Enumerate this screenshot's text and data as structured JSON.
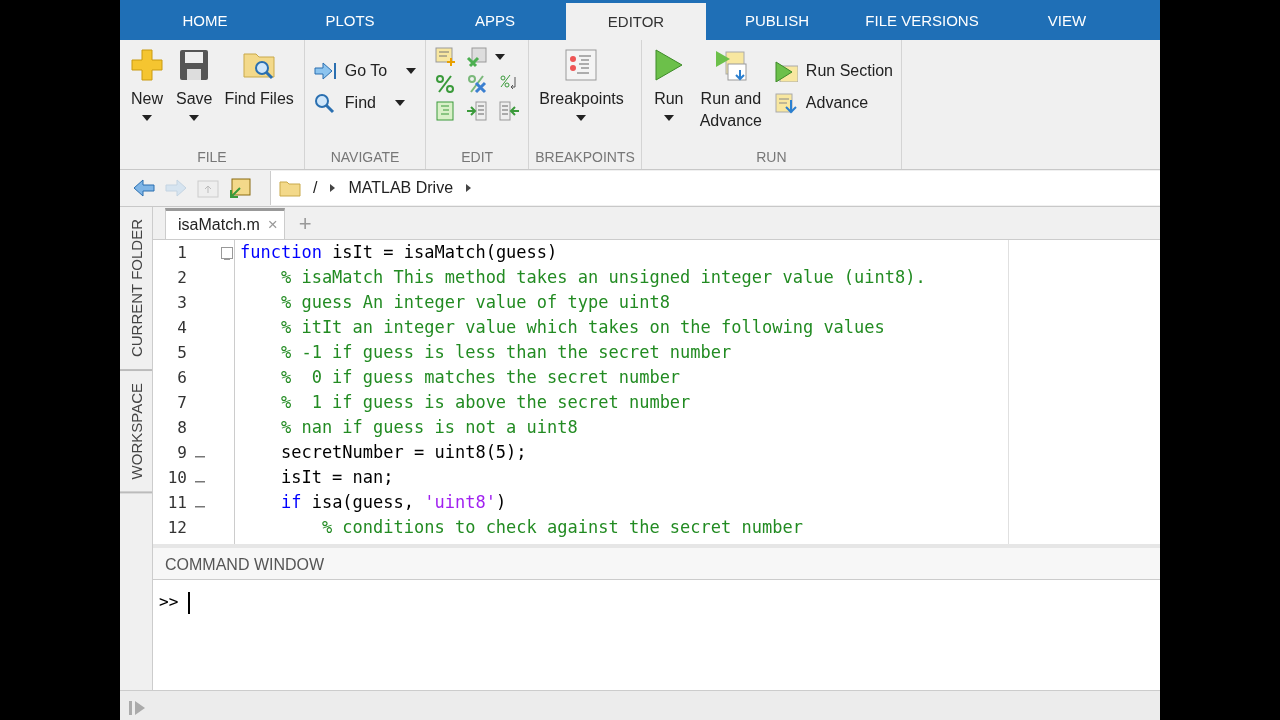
{
  "tabs": [
    {
      "label": "HOME",
      "selected": false
    },
    {
      "label": "PLOTS",
      "selected": false
    },
    {
      "label": "APPS",
      "selected": false
    },
    {
      "label": "EDITOR",
      "selected": true
    },
    {
      "label": "PUBLISH",
      "selected": false
    },
    {
      "label": "FILE VERSIONS",
      "selected": false
    },
    {
      "label": "VIEW",
      "selected": false
    }
  ],
  "ribbon": {
    "groups": [
      {
        "label": "FILE",
        "kind": "large",
        "buttons": [
          {
            "label": "New",
            "dropdown": true
          },
          {
            "label": "Save",
            "dropdown": true
          },
          {
            "label": "Find Files",
            "dropdown": false
          }
        ]
      },
      {
        "label": "NAVIGATE",
        "kind": "small",
        "buttons": [
          {
            "label": "Go To",
            "dropdown": true
          },
          {
            "label": "Find",
            "dropdown": true
          }
        ]
      },
      {
        "label": "EDIT",
        "kind": "icons",
        "rows": [
          [
            {
              "dropdown": false
            },
            {
              "dropdown": true
            }
          ],
          [
            {
              "dropdown": false
            },
            {
              "dropdown": false
            },
            {
              "dropdown": false
            }
          ],
          [
            {
              "dropdown": false
            },
            {
              "dropdown": false
            },
            {
              "dropdown": false
            }
          ]
        ]
      },
      {
        "label": "BREAKPOINTS",
        "kind": "large",
        "buttons": [
          {
            "label": "Breakpoints",
            "dropdown": true
          }
        ]
      },
      {
        "label": "RUN",
        "kind": "mixed",
        "buttons": [
          {
            "label": "Run",
            "dropdown": true
          },
          {
            "label": "Run and Advance",
            "dropdown": false
          }
        ],
        "small_buttons": [
          {
            "label": "Run Section",
            "dropdown": false
          },
          {
            "label": "Advance",
            "dropdown": false
          }
        ]
      }
    ]
  },
  "address_bar": {
    "nav_buttons": [
      {
        "disabled": false
      },
      {
        "disabled": true
      },
      {
        "disabled": true
      },
      {
        "disabled": false
      }
    ],
    "path": [
      {
        "label": "/"
      },
      {
        "label": "MATLAB Drive"
      }
    ]
  },
  "side_panels": [
    {
      "label": "CURRENT FOLDER"
    },
    {
      "label": "WORKSPACE"
    }
  ],
  "editor": {
    "tabs": [
      {
        "label": "isaMatch.m",
        "selected": true,
        "close": "×"
      }
    ],
    "new_tab": "+",
    "lines": [
      {
        "number": "1",
        "fold": true,
        "executable": false,
        "tokens": [
          {
            "kind": "keyword",
            "text": "function"
          },
          {
            "kind": "plain",
            "text": " isIt = isaMatch(guess)"
          }
        ]
      },
      {
        "number": "2",
        "fold": false,
        "executable": false,
        "tokens": [
          {
            "kind": "comment",
            "text": "    % isaMatch This method takes an unsigned integer value (uint8)."
          }
        ]
      },
      {
        "number": "3",
        "fold": false,
        "executable": false,
        "tokens": [
          {
            "kind": "comment",
            "text": "    % guess An integer value of type uint8"
          }
        ]
      },
      {
        "number": "4",
        "fold": false,
        "executable": false,
        "tokens": [
          {
            "kind": "comment",
            "text": "    % itIt an integer value which takes on the following values"
          }
        ]
      },
      {
        "number": "5",
        "fold": false,
        "executable": false,
        "tokens": [
          {
            "kind": "comment",
            "text": "    % -1 if guess is less than the secret number"
          }
        ]
      },
      {
        "number": "6",
        "fold": false,
        "executable": false,
        "tokens": [
          {
            "kind": "comment",
            "text": "    %  0 if guess matches the secret number"
          }
        ]
      },
      {
        "number": "7",
        "fold": false,
        "executable": false,
        "tokens": [
          {
            "kind": "comment",
            "text": "    %  1 if guess is above the secret number"
          }
        ]
      },
      {
        "number": "8",
        "fold": false,
        "executable": false,
        "tokens": [
          {
            "kind": "comment",
            "text": "    % nan if guess is not a uint8"
          }
        ]
      },
      {
        "number": "9",
        "fold": false,
        "executable": true,
        "tokens": [
          {
            "kind": "plain",
            "text": "    secretNumber = uint8(5);"
          }
        ]
      },
      {
        "number": "10",
        "fold": false,
        "executable": true,
        "tokens": [
          {
            "kind": "plain",
            "text": "    isIt = nan;"
          }
        ]
      },
      {
        "number": "11",
        "fold": false,
        "executable": true,
        "tokens": [
          {
            "kind": "keyword",
            "text": "    if"
          },
          {
            "kind": "plain",
            "text": " isa(guess, "
          },
          {
            "kind": "string",
            "text": "'uint8'"
          },
          {
            "kind": "plain",
            "text": ")"
          }
        ]
      },
      {
        "number": "12",
        "fold": false,
        "executable": false,
        "tokens": [
          {
            "kind": "comment",
            "text": "        % conditions to check against the secret number"
          }
        ]
      }
    ]
  },
  "command_window": {
    "title": "COMMAND WINDOW",
    "prompt": ">>"
  }
}
